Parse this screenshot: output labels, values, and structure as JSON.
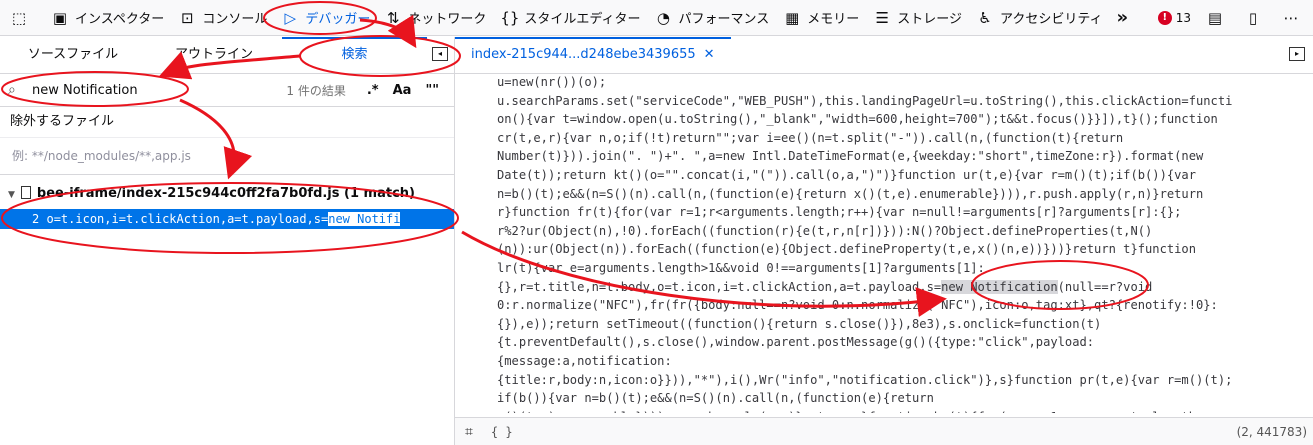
{
  "toolbar": {
    "items": [
      {
        "label": "インスペクター",
        "icon": "inspector-icon"
      },
      {
        "label": "コンソール",
        "icon": "console-icon"
      },
      {
        "label": "デバッガー",
        "icon": "debugger-icon"
      },
      {
        "label": "ネットワーク",
        "icon": "network-icon"
      },
      {
        "label": "スタイルエディター",
        "icon": "style-editor-icon"
      },
      {
        "label": "パフォーマンス",
        "icon": "performance-icon"
      },
      {
        "label": "メモリー",
        "icon": "memory-icon"
      },
      {
        "label": "ストレージ",
        "icon": "storage-icon"
      },
      {
        "label": "アクセシビリティ",
        "icon": "accessibility-icon"
      }
    ],
    "more": "»",
    "error_count": "13",
    "accent": "#0060df"
  },
  "left": {
    "tabs": [
      "ソースファイル",
      "アウトライン",
      "検索"
    ],
    "search": {
      "query": "new Notification",
      "result_count": "1 件の結果",
      "modifiers": [
        ".*",
        "Aa",
        "\"\""
      ]
    },
    "exclude_label": "除外するファイル",
    "exclude_placeholder": "例: **/node_modules/**,app.js",
    "file": "bee-iframe/index-215c944c0ff2fa7b0fd.js (1 match)",
    "match": {
      "line": "2",
      "prefix": "o=t.icon,i=t.clickAction,a=t.payload,s=",
      "highlight": "new Notifi"
    }
  },
  "right": {
    "tab": "index-215c944...d248ebe3439655",
    "status_position": "(2, 441783)",
    "braces": "{ }",
    "code_lines": [
      "u=new(nr())(o);",
      "u.searchParams.set(\"serviceCode\",\"WEB_PUSH\"),this.landingPageUrl=u.toString(),this.clickAction=functi",
      "on(){var t=window.open(u.toString(),\"_blank\",\"width=600,height=700\");t&&t.focus()}}]),t}();function",
      "cr(t,e,r){var n,o;if(!t)return\"\";var i=ee()(n=t.split(\"-\")).call(n,(function(t){return",
      "Number(t)})).join(\". \")+\". \",a=new Intl.DateTimeFormat(e,{weekday:\"short\",timeZone:r}).format(new",
      "Date(t));return kt()(o=\"\".concat(i,\"(\")).call(o,a,\")\")}function ur(t,e){var r=m()(t);if(b()){var",
      "n=b()(t);e&&(n=S()(n).call(n,(function(e){return x()(t,e).enumerable}))),r.push.apply(r,n)}return",
      "r}function fr(t){for(var r=1;r<arguments.length;r++){var n=null!=arguments[r]?arguments[r]:{};",
      "r%2?ur(Object(n),!0).forEach((function(r){e(t,r,n[r])})):N()?Object.defineProperties(t,N()",
      "(n)):ur(Object(n)).forEach((function(e){Object.defineProperty(t,e,x()(n,e))}))}return t}function",
      "lr(t){var e=arguments.length>1&&void 0!==arguments[1]?arguments[1]:",
      "{},r=t.title,n=t.body,o=t.icon,i=t.clickAction,a=t.payload,s=",
      "0:r.normalize(\"NFC\"),fr(fr({body:null==n?void 0:n.normalize(\"NFC\"),icon:o,tag:xt},qt?{renotify:!0}:",
      "{}),e));return setTimeout((function(){return s.close()}),8e3),s.onclick=function(t)",
      "{t.preventDefault(),s.close(),window.parent.postMessage(g()({type:\"click\",payload:",
      "{message:a,notification:",
      "{title:r,body:n,icon:o}})),\"*\"),i(),Wr(\"info\",\"notification.click\")},s}function pr(t,e){var r=m()(t);",
      "if(b()){var n=b()(t);e&&(n=S()(n).call(n,(function(e){return",
      "x()(t,e).enumerable}))),r.push.apply(r,n)}return r}function hr(t){for(var r=1;r<arguments.length;"
    ],
    "code_highlight": "new Notification",
    "code_highlight_suffix": "(null==r?void"
  }
}
